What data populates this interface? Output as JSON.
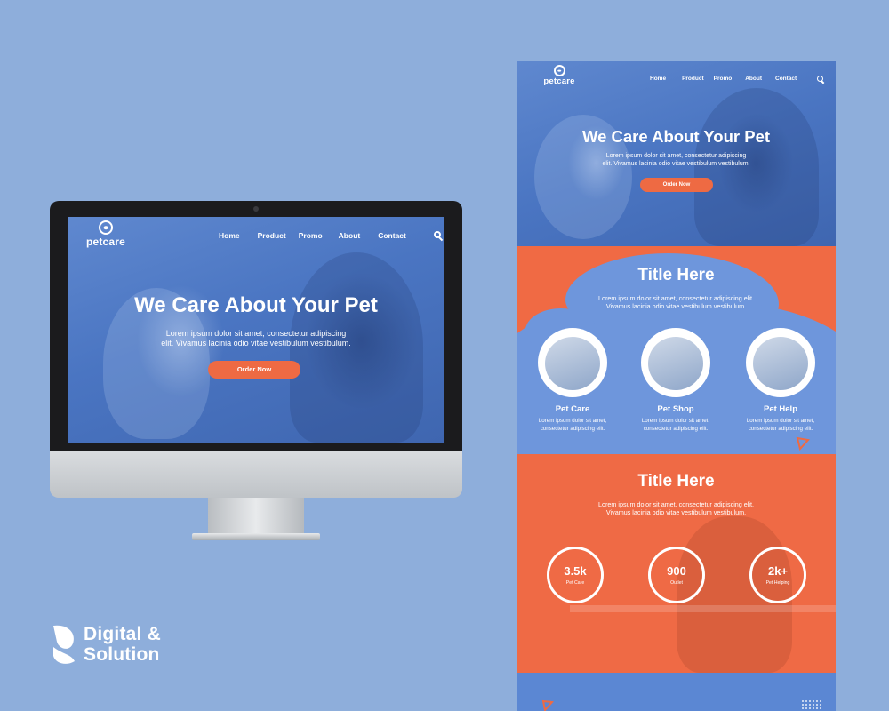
{
  "site": {
    "logo_text": "petcare",
    "nav": [
      "Home",
      "Product",
      "Promo",
      "About",
      "Contact"
    ],
    "hero_title": "We Care About Your Pet",
    "hero_sub_line1": "Lorem ipsum dolor sit amet, consectetur adipiscing",
    "hero_sub_line2": "elit. Vivamus lacinia odio vitae vestibulum vestibulum.",
    "cta_label": "Order Now"
  },
  "services": {
    "title": "Title Here",
    "sub_line1": "Lorem ipsum dolor sit amet, consectetur adipiscing elit.",
    "sub_line2": "Vivamus lacinia odio vitae vestibulum vestibulum.",
    "items": [
      {
        "name": "Pet Care",
        "desc_line1": "Lorem ipsum dolor sit amet,",
        "desc_line2": "consectetur adipiscing elit."
      },
      {
        "name": "Pet Shop",
        "desc_line1": "Lorem ipsum dolor sit amet,",
        "desc_line2": "consectetur adipiscing elit."
      },
      {
        "name": "Pet Help",
        "desc_line1": "Lorem ipsum dolor sit amet,",
        "desc_line2": "consectetur adipiscing elit."
      }
    ]
  },
  "stats": {
    "title": "Title Here",
    "sub_line1": "Lorem ipsum dolor sit amet, consectetur adipiscing elit.",
    "sub_line2": "Vivamus lacinia odio vitae vestibulum vestibulum.",
    "items": [
      {
        "value": "3.5k",
        "label": "Pet Care"
      },
      {
        "value": "900",
        "label": "Outlet"
      },
      {
        "value": "2k+",
        "label": "Pet Helping"
      }
    ]
  },
  "brand": {
    "line1": "Digital &",
    "line2": "Solution"
  },
  "colors": {
    "background": "#8eaedb",
    "primary_blue": "#5b87d3",
    "accent_orange": "#ee6a43"
  },
  "icons": {
    "search": "search-icon",
    "logo": "paw-icon"
  }
}
